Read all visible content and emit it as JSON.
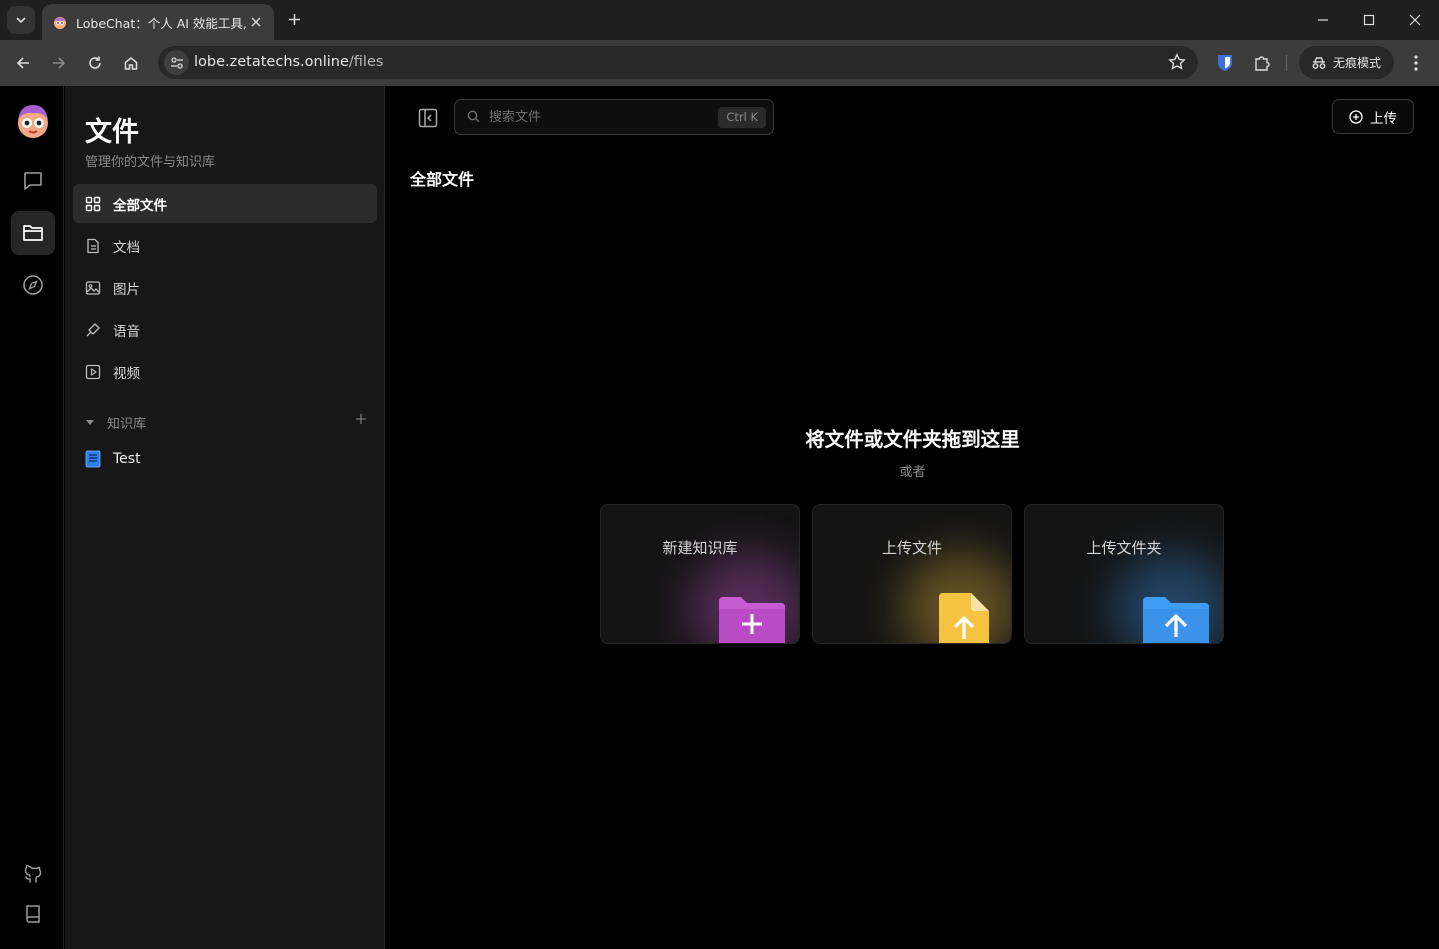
{
  "browser": {
    "tab_title": "LobeChat：个人 AI 效能工具,",
    "url_host": "lobe.zetatechs.online",
    "url_path": "/files",
    "incognito_label": "无痕模式"
  },
  "rail": {
    "items": [
      "chat",
      "files",
      "discover"
    ],
    "bottom": [
      "github",
      "docs"
    ]
  },
  "sidebar": {
    "title": "文件",
    "subtitle": "管理你的文件与知识库",
    "menu": [
      {
        "label": "全部文件",
        "icon": "grid-icon"
      },
      {
        "label": "文档",
        "icon": "document-icon"
      },
      {
        "label": "图片",
        "icon": "image-icon"
      },
      {
        "label": "语音",
        "icon": "mic-icon"
      },
      {
        "label": "视频",
        "icon": "video-icon"
      }
    ],
    "knowledge_base": {
      "header": "知识库",
      "items": [
        {
          "label": "Test"
        }
      ]
    }
  },
  "main": {
    "search_placeholder": "搜索文件",
    "search_shortcut": "Ctrl K",
    "upload_label": "上传",
    "section_title": "全部文件",
    "drop_title": "将文件或文件夹拖到这里",
    "drop_or": "或者",
    "cards": [
      {
        "label": "新建知识库",
        "color": "#c85ad2"
      },
      {
        "label": "上传文件",
        "color": "#f5c242"
      },
      {
        "label": "上传文件夹",
        "color": "#3f9cf5"
      }
    ]
  }
}
